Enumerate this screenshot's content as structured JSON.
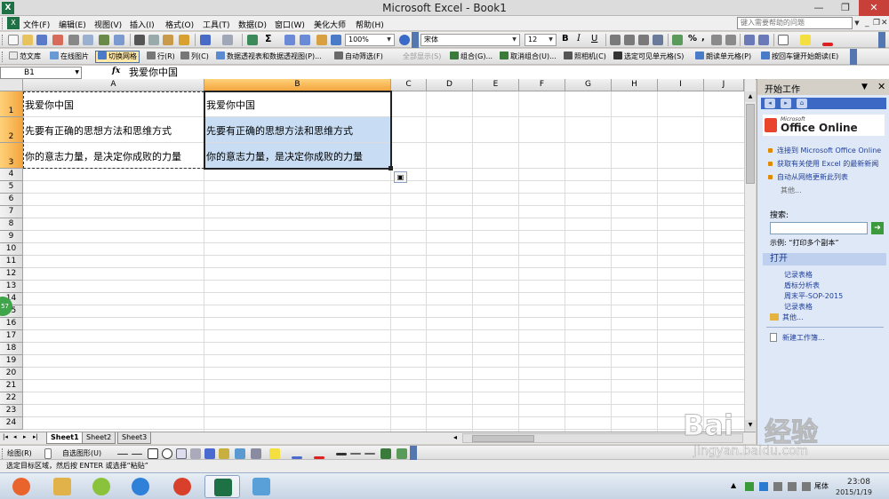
{
  "window": {
    "title": "Microsoft Excel - Book1",
    "app_icon": "X",
    "minimize": "—",
    "restore": "❐",
    "close": "✕"
  },
  "menu": {
    "items": [
      "文件(F)",
      "编辑(E)",
      "视图(V)",
      "插入(I)",
      "格式(O)",
      "工具(T)",
      "数据(D)",
      "窗口(W)",
      "美化大师",
      "帮助(H)"
    ],
    "help_placeholder": "键入需要帮助的问题",
    "mdi_min": "_",
    "mdi_restore": "❐",
    "mdi_close": "✕"
  },
  "standard_toolbar": {
    "zoom": "100%",
    "sigma": "Σ",
    "font_name": "宋体",
    "font_size": "12",
    "bold": "B",
    "italic": "I",
    "underline": "U",
    "percent": "%",
    "comma": ","
  },
  "addin_toolbar": {
    "buttons": [
      {
        "label": "范文库",
        "icon_color": "#e8e8e8",
        "state": "normal"
      },
      {
        "label": "在线图片",
        "icon_color": "#6a9ad6",
        "state": "normal"
      },
      {
        "label": "切换网格",
        "icon_color": "#4a7bc8",
        "state": "pressed"
      },
      {
        "label": "行(R)",
        "icon_color": "#777777",
        "state": "normal"
      },
      {
        "label": "列(C)",
        "icon_color": "#777777",
        "state": "normal"
      },
      {
        "label": "数据透视表和数据透视图(P)...",
        "icon_color": "#5a8ad0",
        "state": "normal"
      },
      {
        "label": "自动筛选(F)",
        "icon_color": "#6a6a6a",
        "state": "normal"
      },
      {
        "label": "全部显示(S)",
        "icon_color": "#bbbbbb",
        "state": "disabled"
      },
      {
        "label": "组合(G)...",
        "icon_color": "#3a7a3a",
        "state": "normal"
      },
      {
        "label": "取消组合(U)...",
        "icon_color": "#3a7a3a",
        "state": "normal"
      },
      {
        "label": "照相机(C)",
        "icon_color": "#555555",
        "state": "normal"
      },
      {
        "label": "选定可见单元格(S)",
        "icon_color": "#333333",
        "state": "normal"
      },
      {
        "label": "朗读单元格(P)",
        "icon_color": "#4a7bc8",
        "state": "normal"
      },
      {
        "label": "按回车键开始朗读(E)",
        "icon_color": "#4a7bc8",
        "state": "normal"
      }
    ]
  },
  "formula_bar": {
    "name_box": "B1",
    "fx": "fx",
    "formula": "我爱你中国"
  },
  "sheet": {
    "columns": [
      "A",
      "B",
      "C",
      "D",
      "E",
      "F",
      "G",
      "H",
      "I",
      "J"
    ],
    "selected_column": "B",
    "rows": [
      "1",
      "2",
      "3",
      "4",
      "5",
      "6",
      "7",
      "8",
      "9",
      "10",
      "11",
      "12",
      "13",
      "14",
      "15",
      "16",
      "17",
      "18",
      "19",
      "20",
      "21",
      "22",
      "23",
      "24"
    ],
    "cells": [
      {
        "ref": "A1",
        "value": "我爱你中国"
      },
      {
        "ref": "A2",
        "value": "先要有正确的思想方法和思维方式"
      },
      {
        "ref": "A3",
        "value": "你的意志力量，是决定你成败的力量"
      },
      {
        "ref": "B1",
        "value": "我爱你中国"
      },
      {
        "ref": "B2",
        "value": "先要有正确的思想方法和思维方式"
      },
      {
        "ref": "B3",
        "value": "你的意志力量，是决定你成败的力量"
      }
    ],
    "paste_options_icon": "clipboard-icon"
  },
  "sheet_tabs": {
    "nav": [
      "|◂",
      "◂",
      "▸",
      "▸|"
    ],
    "tabs": [
      "Sheet1",
      "Sheet2",
      "Sheet3"
    ],
    "active": "Sheet1"
  },
  "drawing_toolbar": {
    "draw": "绘图(R)",
    "autoshapes": "自选图形(U)"
  },
  "status": {
    "text": "选定目标区域，然后按 ENTER 或选择“粘贴”"
  },
  "task_pane": {
    "title": "开始工作",
    "dropdown": "▼",
    "close": "✕",
    "logo_small": "Microsoft",
    "logo_big": "Office Online",
    "links": [
      "连接到 Microsoft Office Online",
      "获取有关使用 Excel 的最新新闻",
      "自动从网络更新此列表"
    ],
    "more": "其他...",
    "search_label": "搜索:",
    "search_go": "➔",
    "example": "示例: “打印多个副本”",
    "open_section": "打开",
    "recent_files": [
      "记录表格",
      "盾标分析表",
      "周末平-SOP-2015",
      "记录表格"
    ],
    "open_more": "其他...",
    "new_workbook": "新建工作簿..."
  },
  "taskbar": {
    "apps": [
      {
        "name": "start",
        "color": "#e8642c",
        "active": false
      },
      {
        "name": "explorer",
        "color": "#e2b24a",
        "active": false
      },
      {
        "name": "media",
        "color": "#8ac23c",
        "active": false
      },
      {
        "name": "ie",
        "color": "#2f80d8",
        "active": false
      },
      {
        "name": "chrome",
        "color": "#d8402c",
        "active": false
      },
      {
        "name": "excel",
        "color": "#1e7145",
        "active": true
      },
      {
        "name": "app",
        "color": "#5aa0d8",
        "active": false
      }
    ],
    "ime": "尾体",
    "time": "23:08",
    "date": "2015/1/19"
  },
  "watermark": {
    "brand": "Bai",
    "brand_cn": "经验",
    "url": "jingyan.baidu.com"
  },
  "colors": {
    "header_selected": "#f3a53e",
    "selection_fill": "#c8ddf4",
    "task_pane_bg": "#dfe8f7"
  }
}
